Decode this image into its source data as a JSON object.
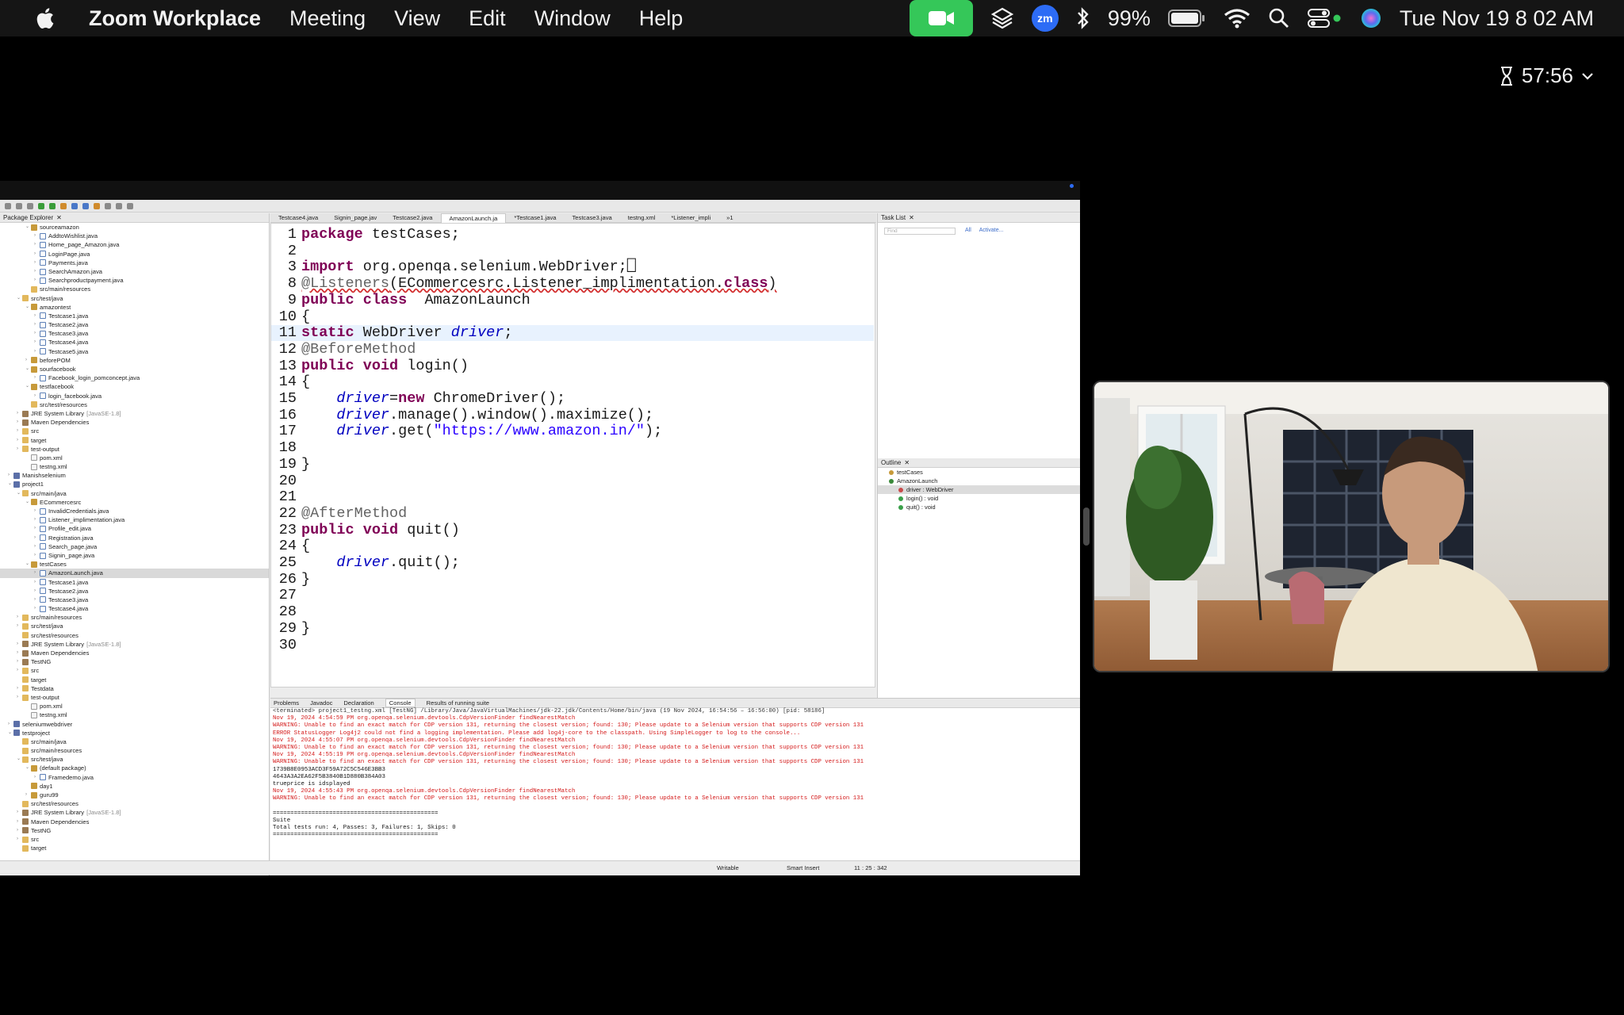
{
  "menubar": {
    "app_name": "Zoom Workplace",
    "menus": [
      "Meeting",
      "View",
      "Edit",
      "Window",
      "Help"
    ],
    "battery": "99%",
    "clock": "Tue Nov 19  8 02 AM",
    "zoom_badge": "zm"
  },
  "zoom": {
    "timer": "57:56"
  },
  "eclipse": {
    "package_explorer_title": "Package Explorer",
    "tree": [
      {
        "indent": 1,
        "twisty": "v",
        "icon": "pkgi",
        "label": "sourceamazon"
      },
      {
        "indent": 2,
        "twisty": ">",
        "icon": "java",
        "label": "AddtoWishlist.java"
      },
      {
        "indent": 2,
        "twisty": ">",
        "icon": "java",
        "label": "Home_page_Amazon.java"
      },
      {
        "indent": 2,
        "twisty": ">",
        "icon": "java",
        "label": "LoginPage.java"
      },
      {
        "indent": 2,
        "twisty": ">",
        "icon": "java",
        "label": "Payments.java"
      },
      {
        "indent": 2,
        "twisty": ">",
        "icon": "java",
        "label": "SearchAmazon.java"
      },
      {
        "indent": 2,
        "twisty": ">",
        "icon": "java",
        "label": "Searchproductpayment.java"
      },
      {
        "indent": 1,
        "twisty": "",
        "icon": "fold",
        "label": "src/main/resources"
      },
      {
        "indent": 0,
        "twisty": "v",
        "icon": "fold",
        "label": "src/test/java"
      },
      {
        "indent": 1,
        "twisty": "v",
        "icon": "pkgi",
        "label": "amazontest"
      },
      {
        "indent": 2,
        "twisty": ">",
        "icon": "java",
        "label": "Testcase1.java"
      },
      {
        "indent": 2,
        "twisty": ">",
        "icon": "java",
        "label": "Testcase2.java"
      },
      {
        "indent": 2,
        "twisty": ">",
        "icon": "java",
        "label": "Testcase3.java"
      },
      {
        "indent": 2,
        "twisty": ">",
        "icon": "java",
        "label": "Testcase4.java"
      },
      {
        "indent": 2,
        "twisty": ">",
        "icon": "java",
        "label": "Testcase5.java"
      },
      {
        "indent": 1,
        "twisty": ">",
        "icon": "pkgi",
        "label": "beforePOM"
      },
      {
        "indent": 1,
        "twisty": "v",
        "icon": "pkgi",
        "label": "sourfacebook"
      },
      {
        "indent": 2,
        "twisty": ">",
        "icon": "java",
        "label": "Facebook_login_pomconcept.java"
      },
      {
        "indent": 1,
        "twisty": "v",
        "icon": "pkgi",
        "label": "testfacebook"
      },
      {
        "indent": 2,
        "twisty": ">",
        "icon": "java",
        "label": "login_facebook.java"
      },
      {
        "indent": 1,
        "twisty": "",
        "icon": "fold",
        "label": "src/test/resources"
      },
      {
        "indent": 0,
        "twisty": ">",
        "icon": "lib",
        "label": "JRE System Library",
        "extra": "[JavaSE-1.8]"
      },
      {
        "indent": 0,
        "twisty": ">",
        "icon": "lib",
        "label": "Maven Dependencies"
      },
      {
        "indent": 0,
        "twisty": ">",
        "icon": "fold",
        "label": "src"
      },
      {
        "indent": 0,
        "twisty": ">",
        "icon": "fold",
        "label": "target"
      },
      {
        "indent": 0,
        "twisty": ">",
        "icon": "fold",
        "label": "test-output"
      },
      {
        "indent": 1,
        "twisty": "",
        "icon": "xml",
        "label": "pom.xml"
      },
      {
        "indent": 1,
        "twisty": "",
        "icon": "xml",
        "label": "testng.xml"
      },
      {
        "indent": -1,
        "twisty": ">",
        "icon": "proj",
        "label": "Manishselenium"
      },
      {
        "indent": -1,
        "twisty": "v",
        "icon": "proj",
        "label": "project1"
      },
      {
        "indent": 0,
        "twisty": "v",
        "icon": "fold",
        "label": "src/main/java"
      },
      {
        "indent": 1,
        "twisty": "v",
        "icon": "pkgi",
        "label": "ECommercesrc"
      },
      {
        "indent": 2,
        "twisty": ">",
        "icon": "java",
        "label": "InvalidCredentials.java"
      },
      {
        "indent": 2,
        "twisty": ">",
        "icon": "java",
        "label": "Listener_implimentation.java"
      },
      {
        "indent": 2,
        "twisty": ">",
        "icon": "java",
        "label": "Profile_edit.java"
      },
      {
        "indent": 2,
        "twisty": ">",
        "icon": "java",
        "label": "Registration.java"
      },
      {
        "indent": 2,
        "twisty": ">",
        "icon": "java",
        "label": "Search_page.java"
      },
      {
        "indent": 2,
        "twisty": ">",
        "icon": "java",
        "label": "Signin_page.java"
      },
      {
        "indent": 1,
        "twisty": "v",
        "icon": "pkgi",
        "label": "testCases"
      },
      {
        "indent": 2,
        "twisty": ">",
        "icon": "java",
        "label": "AmazonLaunch.java",
        "selected": true
      },
      {
        "indent": 2,
        "twisty": ">",
        "icon": "java",
        "label": "Testcase1.java"
      },
      {
        "indent": 2,
        "twisty": ">",
        "icon": "java",
        "label": "Testcase2.java"
      },
      {
        "indent": 2,
        "twisty": ">",
        "icon": "java",
        "label": "Testcase3.java"
      },
      {
        "indent": 2,
        "twisty": ">",
        "icon": "java",
        "label": "Testcase4.java"
      },
      {
        "indent": 0,
        "twisty": ">",
        "icon": "fold",
        "label": "src/main/resources"
      },
      {
        "indent": 0,
        "twisty": ">",
        "icon": "fold",
        "label": "src/test/java"
      },
      {
        "indent": 0,
        "twisty": "",
        "icon": "fold",
        "label": "src/test/resources"
      },
      {
        "indent": 0,
        "twisty": ">",
        "icon": "lib",
        "label": "JRE System Library",
        "extra": "[JavaSE-1.8]"
      },
      {
        "indent": 0,
        "twisty": ">",
        "icon": "lib",
        "label": "Maven Dependencies"
      },
      {
        "indent": 0,
        "twisty": ">",
        "icon": "lib",
        "label": "TestNG"
      },
      {
        "indent": 0,
        "twisty": ">",
        "icon": "fold",
        "label": "src"
      },
      {
        "indent": 0,
        "twisty": "",
        "icon": "fold",
        "label": "target"
      },
      {
        "indent": 0,
        "twisty": ">",
        "icon": "fold",
        "label": "Testdata"
      },
      {
        "indent": 0,
        "twisty": ">",
        "icon": "fold",
        "label": "test-output"
      },
      {
        "indent": 1,
        "twisty": "",
        "icon": "xml",
        "label": "pom.xml"
      },
      {
        "indent": 1,
        "twisty": "",
        "icon": "xml",
        "label": "testng.xml"
      },
      {
        "indent": -1,
        "twisty": ">",
        "icon": "proj",
        "label": "seleniumwebdriver"
      },
      {
        "indent": -1,
        "twisty": "v",
        "icon": "proj",
        "label": "testproject"
      },
      {
        "indent": 0,
        "twisty": "",
        "icon": "fold",
        "label": "src/main/java"
      },
      {
        "indent": 0,
        "twisty": "",
        "icon": "fold",
        "label": "src/main/resources"
      },
      {
        "indent": 0,
        "twisty": "v",
        "icon": "fold",
        "label": "src/test/java"
      },
      {
        "indent": 1,
        "twisty": "v",
        "icon": "pkgi",
        "label": "(default package)"
      },
      {
        "indent": 2,
        "twisty": ">",
        "icon": "java",
        "label": "Framedemo.java"
      },
      {
        "indent": 1,
        "twisty": "",
        "icon": "pkgi",
        "label": "day1"
      },
      {
        "indent": 1,
        "twisty": ">",
        "icon": "pkgi",
        "label": "guru99"
      },
      {
        "indent": 0,
        "twisty": "",
        "icon": "fold",
        "label": "src/test/resources"
      },
      {
        "indent": 0,
        "twisty": ">",
        "icon": "lib",
        "label": "JRE System Library",
        "extra": "[JavaSE-1.8]"
      },
      {
        "indent": 0,
        "twisty": ">",
        "icon": "lib",
        "label": "Maven Dependencies"
      },
      {
        "indent": 0,
        "twisty": ">",
        "icon": "lib",
        "label": "TestNG"
      },
      {
        "indent": 0,
        "twisty": ">",
        "icon": "fold",
        "label": "src"
      },
      {
        "indent": 0,
        "twisty": "",
        "icon": "fold",
        "label": "target"
      }
    ],
    "editor_tabs": [
      "Testcase4.java",
      "Signin_page.jav",
      "Testcase2.java",
      "AmazonLaunch.ja",
      "*Testcase1.java",
      "Testcase3.java",
      "testng.xml",
      "*Listener_impli",
      "»1"
    ],
    "active_tab_index": 3,
    "code": [
      {
        "n": "1",
        "html": "<span class='kw'>package</span> testCases;"
      },
      {
        "n": "2",
        "html": ""
      },
      {
        "n": "3",
        "html": "<span class='kw'>import</span> org.openqa.selenium.WebDriver;⎕"
      },
      {
        "n": "8",
        "html": "<span class='ann err'>@Listeners</span><span class='err'>(ECommercesrc.Listener_implimentation.</span><span class='kw err'>class</span><span class='err'>)</span>"
      },
      {
        "n": "9",
        "html": "<span class='kw'>public</span> <span class='kw'>class</span>  AmazonLaunch"
      },
      {
        "n": "10",
        "html": "{"
      },
      {
        "n": "11",
        "html": "<span class='kw'>static</span> WebDriver <span class='fld'>driver</span>;",
        "hl": true
      },
      {
        "n": "12",
        "html": "<span class='ann'>@BeforeMethod</span>"
      },
      {
        "n": "13",
        "html": "<span class='kw'>public</span> <span class='kw'>void</span> login()"
      },
      {
        "n": "14",
        "html": "{"
      },
      {
        "n": "15",
        "html": "    <span class='fld'>driver</span>=<span class='kw'>new</span> ChromeDriver();"
      },
      {
        "n": "16",
        "html": "    <span class='fld'>driver</span>.manage().window().maximize();"
      },
      {
        "n": "17",
        "html": "    <span class='fld'>driver</span>.get(<span class='str'>\"https://www.amazon.in/\"</span>);"
      },
      {
        "n": "18",
        "html": ""
      },
      {
        "n": "19",
        "html": "}"
      },
      {
        "n": "20",
        "html": ""
      },
      {
        "n": "21",
        "html": ""
      },
      {
        "n": "22",
        "html": "<span class='ann'>@AfterMethod</span>"
      },
      {
        "n": "23",
        "html": "<span class='kw'>public</span> <span class='kw'>void</span> quit()"
      },
      {
        "n": "24",
        "html": "{"
      },
      {
        "n": "25",
        "html": "    <span class='fld'>driver</span>.quit();"
      },
      {
        "n": "26",
        "html": "}"
      },
      {
        "n": "27",
        "html": ""
      },
      {
        "n": "28",
        "html": ""
      },
      {
        "n": "29",
        "html": "}"
      },
      {
        "n": "30",
        "html": ""
      }
    ],
    "task_list_title": "Task List",
    "find_placeholder": "Find",
    "find_all": "All",
    "find_activate": "Activate...",
    "outline_title": "Outline",
    "outline": [
      {
        "label": "testCases",
        "color": "#c79a3a",
        "indent": 0
      },
      {
        "label": "AmazonLaunch",
        "color": "#3a8a3a",
        "indent": 0
      },
      {
        "label": "driver : WebDriver",
        "color": "#c94a4a",
        "indent": 1,
        "selected": true
      },
      {
        "label": "login() : void",
        "color": "#3aa04a",
        "indent": 1
      },
      {
        "label": "quit() : void",
        "color": "#3aa04a",
        "indent": 1
      }
    ],
    "console_tabs": [
      "Problems",
      "Javadoc",
      "Declaration",
      "Console",
      "Results of running suite"
    ],
    "console_active": 3,
    "console_lines": [
      {
        "c": "grey",
        "t": "<terminated> project1_testng.xml [TestNG] /Library/Java/JavaVirtualMachines/jdk-22.jdk/Contents/Home/bin/java (19 Nov 2024, 16:54:56 – 16:56:00) [pid: 58186]"
      },
      {
        "c": "red",
        "t": "Nov 19, 2024 4:54:59 PM org.openqa.selenium.devtools.CdpVersionFinder findNearestMatch"
      },
      {
        "c": "red",
        "t": "WARNING: Unable to find an exact match for CDP version 131, returning the closest version; found: 130; Please update to a Selenium version that supports CDP version 131"
      },
      {
        "c": "red",
        "t": "ERROR StatusLogger Log4j2 could not find a logging implementation. Please add log4j-core to the classpath. Using SimpleLogger to log to the console..."
      },
      {
        "c": "red",
        "t": "Nov 19, 2024 4:55:07 PM org.openqa.selenium.devtools.CdpVersionFinder findNearestMatch"
      },
      {
        "c": "red",
        "t": "WARNING: Unable to find an exact match for CDP version 131, returning the closest version; found: 130; Please update to a Selenium version that supports CDP version 131"
      },
      {
        "c": "red",
        "t": "Nov 19, 2024 4:55:19 PM org.openqa.selenium.devtools.CdpVersionFinder findNearestMatch"
      },
      {
        "c": "red",
        "t": "WARNING: Unable to find an exact match for CDP version 131, returning the closest version; found: 130; Please update to a Selenium version that supports CDP version 131"
      },
      {
        "c": "",
        "t": "1739B8E0953ACD3F59A72C5C546E3BB3"
      },
      {
        "c": "",
        "t": "4643A3A2EA62F5B3840B1D880B384A03"
      },
      {
        "c": "",
        "t": "trueprice is idsplayed"
      },
      {
        "c": "red",
        "t": "Nov 19, 2024 4:55:43 PM org.openqa.selenium.devtools.CdpVersionFinder findNearestMatch"
      },
      {
        "c": "red",
        "t": "WARNING: Unable to find an exact match for CDP version 131, returning the closest version; found: 130; Please update to a Selenium version that supports CDP version 131"
      },
      {
        "c": "",
        "t": ""
      },
      {
        "c": "",
        "t": "==============================================="
      },
      {
        "c": "",
        "t": "Suite"
      },
      {
        "c": "",
        "t": "Total tests run: 4, Passes: 3, Failures: 1, Skips: 0"
      },
      {
        "c": "",
        "t": "==============================================="
      }
    ],
    "status": {
      "writable": "Writable",
      "insert": "Smart Insert",
      "position": "11 : 25 : 342"
    }
  }
}
